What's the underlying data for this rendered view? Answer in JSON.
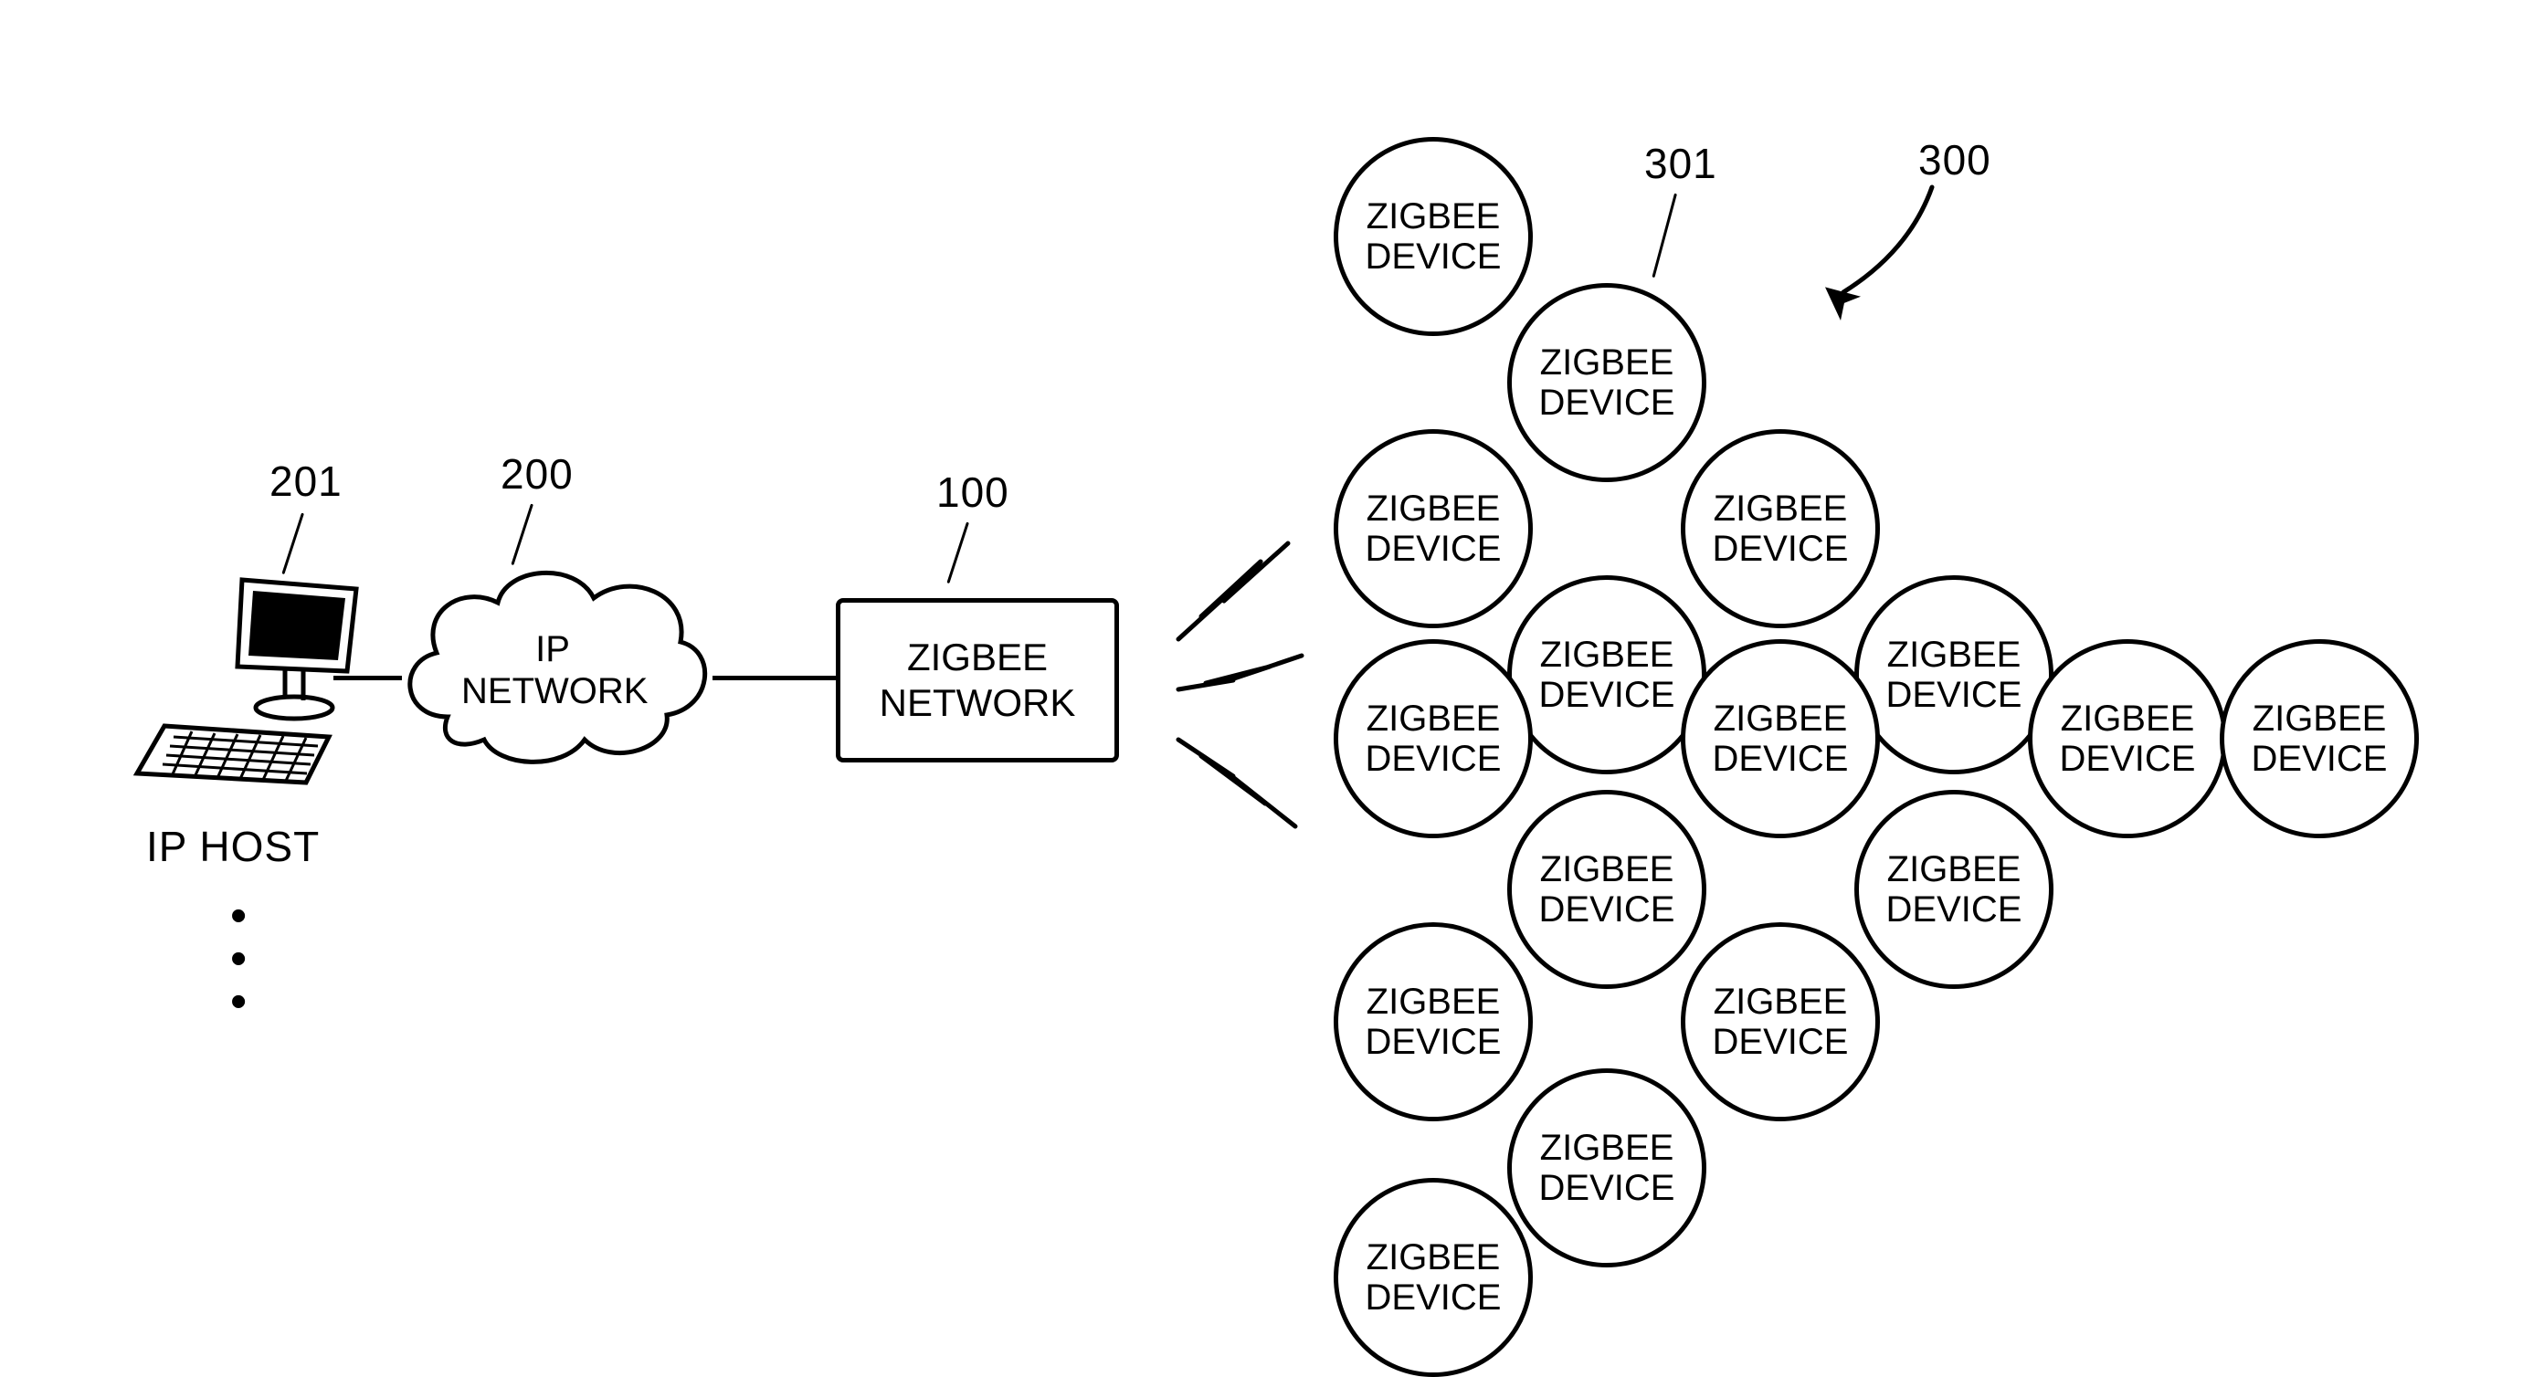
{
  "refs": {
    "r201": "201",
    "r200": "200",
    "r100": "100",
    "r301": "301",
    "r300": "300"
  },
  "ip_host": {
    "caption": "IP HOST"
  },
  "cloud": {
    "label_top": "IP",
    "label_bot": "NETWORK"
  },
  "gateway": {
    "label_top": "ZIGBEE",
    "label_bot": "NETWORK"
  },
  "device_label": "ZIGBEE\nDEVICE"
}
